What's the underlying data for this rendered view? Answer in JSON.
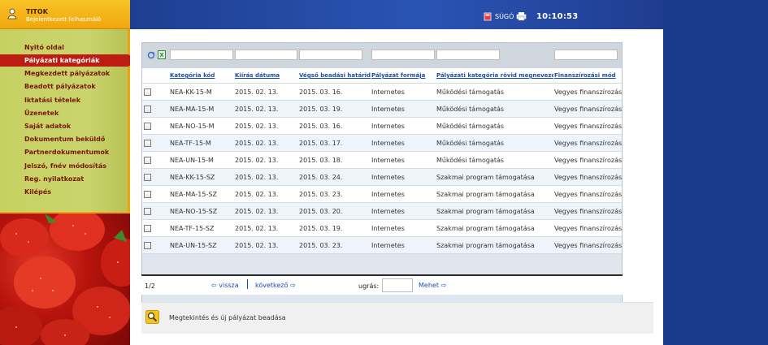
{
  "user": {
    "name": "TITOK",
    "role": "Bejelentkezett felhasználó"
  },
  "header": {
    "help_label": "SÚGÓ",
    "clock": "10:10:53"
  },
  "menu": [
    {
      "label": "Nyitó oldal"
    },
    {
      "label": "Pályázati kategóriák",
      "active": true
    },
    {
      "label": "Megkezdett pályázatok"
    },
    {
      "label": "Beadott pályázatok"
    },
    {
      "label": "Iktatási tételek"
    },
    {
      "label": "Üzenetek"
    },
    {
      "label": "Saját adatok"
    },
    {
      "label": "Dokumentum beküldő"
    },
    {
      "label": "Partnerdokumentumok"
    },
    {
      "label": "Jelszó, fnév módosítás"
    },
    {
      "label": "Reg. nyilatkozat"
    },
    {
      "label": "Kilépés"
    }
  ],
  "grid": {
    "columns": [
      "Kategória kód",
      "Kiírás dátuma",
      "Végső beadási határidő",
      "Pályázat formája",
      "Pályázati kategória rövid megnevezése",
      "Finanszírozási mód"
    ],
    "rows": [
      [
        "NEA-KK-15-M",
        "2015. 02. 13.",
        "2015. 03. 16.",
        "Internetes",
        "Működési támogatás",
        "Vegyes finanszírozás"
      ],
      [
        "NEA-MA-15-M",
        "2015. 02. 13.",
        "2015. 03. 19.",
        "Internetes",
        "Működési támogatás",
        "Vegyes finanszírozás"
      ],
      [
        "NEA-NO-15-M",
        "2015. 02. 13.",
        "2015. 03. 16.",
        "Internetes",
        "Működési támogatás",
        "Vegyes finanszírozás"
      ],
      [
        "NEA-TF-15-M",
        "2015. 02. 13.",
        "2015. 03. 17.",
        "Internetes",
        "Működési támogatás",
        "Vegyes finanszírozás"
      ],
      [
        "NEA-UN-15-M",
        "2015. 02. 13.",
        "2015. 03. 18.",
        "Internetes",
        "Működési támogatás",
        "Vegyes finanszírozás"
      ],
      [
        "NEA-KK-15-SZ",
        "2015. 02. 13.",
        "2015. 03. 24.",
        "Internetes",
        "Szakmai program támogatása",
        "Vegyes finanszírozás"
      ],
      [
        "NEA-MA-15-SZ",
        "2015. 02. 13.",
        "2015. 03. 23.",
        "Internetes",
        "Szakmai program támogatása",
        "Vegyes finanszírozás"
      ],
      [
        "NEA-NO-15-SZ",
        "2015. 02. 13.",
        "2015. 03. 20.",
        "Internetes",
        "Szakmai program támogatása",
        "Vegyes finanszírozás"
      ],
      [
        "NEA-TF-15-SZ",
        "2015. 02. 13.",
        "2015. 03. 19.",
        "Internetes",
        "Szakmai program támogatása",
        "Vegyes finanszírozás"
      ],
      [
        "NEA-UN-15-SZ",
        "2015. 02. 13.",
        "2015. 03. 23.",
        "Internetes",
        "Szakmai program támogatása",
        "Vegyes finanszírozás"
      ]
    ]
  },
  "pager": {
    "page": "1/2",
    "prev_label": "vissza",
    "next_label": "következő",
    "jump_label": "ugrás:",
    "jump_value": "",
    "go_label": "Mehet"
  },
  "action": {
    "label": "Megtekintés és új pályázat beadása"
  }
}
